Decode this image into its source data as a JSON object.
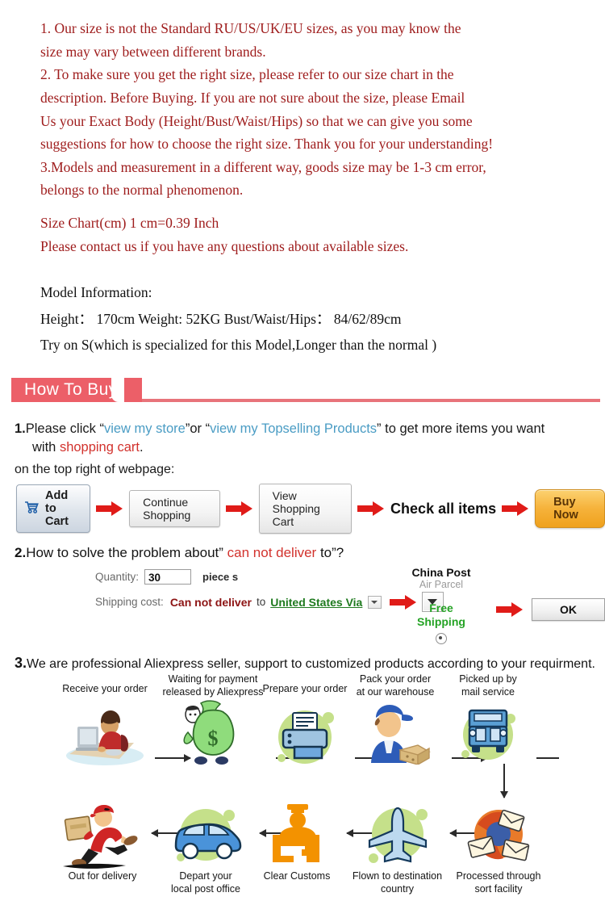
{
  "notice": {
    "lines": [
      "1. Our size is not the Standard RU/US/UK/EU sizes, as you may know the",
      " size may vary between different brands.",
      "2. To make sure you get the right size, please refer to our size chart in the",
      "description. Before Buying. If you are not sure about the size, please Email",
      "Us your Exact Body  (Height/Bust/Waist/Hips) so that we can give you some",
      "suggestions for how to choose the right size. Thank you for your understanding!",
      "3.Models and measurement in a different way, goods size may be 1-3 cm error,",
      "belongs to the normal phenomenon."
    ],
    "size_chart_line": "Size Chart(cm) 1 cm=0.39 Inch",
    "contact_line": " Please contact us if you have any questions about available sizes."
  },
  "model_info": {
    "heading": "Model Information:",
    "measurements": "Height： 170cm Weight: 52KG  Bust/Waist/Hips： 84/62/89cm",
    "try_on": "Try on S(which is specialized for this Model,Longer than the normal )"
  },
  "banner": {
    "title": "How To Buy",
    "bg_color": "#ec5f68"
  },
  "step1": {
    "number": "1.",
    "text_a": "Please click “",
    "link_store": "view my store",
    "text_b": "”or “",
    "link_topselling": "view my Topselling Products",
    "text_c": "” to get  more items you want",
    "text_d": "with ",
    "red_shopping_cart": "shopping cart",
    "text_e": ".",
    "subnote": "on the top right of webpage:"
  },
  "buttons": {
    "add_to_cart": "Add to Cart",
    "cart_icon": "shopping-cart-icon",
    "continue_shopping": "Continue Shopping",
    "view_shopping_cart": "View Shopping Cart",
    "check_all_items": "Check all items",
    "buy_now": "Buy Now"
  },
  "step2": {
    "number": "2.",
    "text_a": "How to solve the problem about” ",
    "red_phrase": "can not deliver",
    "text_b": " to”?",
    "quantity_label": "Quantity:",
    "quantity_value": "30",
    "piece_label": "piece s",
    "shipping_label": "Shipping cost:",
    "cannot_deliver": "Can not deliver",
    "to_word": "to",
    "country": "United States Via",
    "post_name": "China Post",
    "post_sub": "Air Parcel",
    "free_shipping_line1": "Free",
    "free_shipping_line2": "Shipping",
    "free_shipping_color": "#25a325",
    "ok_button": "OK"
  },
  "step3": {
    "number": "3.",
    "text": "We are professional Aliexpress seller, support to customized products according to your requirment."
  },
  "flow": {
    "top_row": [
      {
        "label": "Receive your order",
        "icon": "person-at-computer-icon"
      },
      {
        "label": "Waiting for payment\nreleased by Aliexpress",
        "icon": "money-bag-icon"
      },
      {
        "label": "Prepare your order",
        "icon": "printer-icon"
      },
      {
        "label": "Pack your order\nat our warehouse",
        "icon": "warehouse-worker-icon"
      },
      {
        "label": "Picked up by\nmail service",
        "icon": "mail-truck-icon"
      }
    ],
    "bottom_row": [
      {
        "label": "Out for delivery",
        "icon": "running-courier-icon"
      },
      {
        "label": "Depart your\nlocal post office",
        "icon": "delivery-van-icon"
      },
      {
        "label": "Clear Customs",
        "icon": "customs-officer-icon"
      },
      {
        "label": "Flown to destination\ncountry",
        "icon": "airplane-icon"
      },
      {
        "label": "Processed through\nsort facility",
        "icon": "mail-sorting-icon"
      }
    ]
  }
}
